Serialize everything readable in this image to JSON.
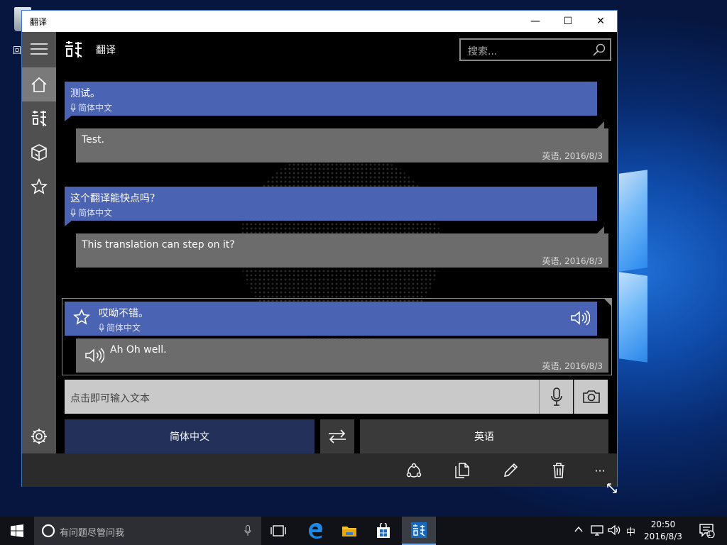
{
  "desktop": {
    "recycle_label": "回"
  },
  "window": {
    "title": "翻译",
    "controls": {
      "minimize": "—",
      "maximize": "☐",
      "close": "✕"
    }
  },
  "app": {
    "name": "翻译",
    "search_placeholder": "搜索..."
  },
  "conversation": [
    {
      "source_text": "测试。",
      "source_lang": "简体中文",
      "translation": "Test.",
      "meta": "英语, 2016/8/3"
    },
    {
      "source_text": "这个翻译能快点吗？",
      "source_lang": "简体中文",
      "translation": "This translation can step on it?",
      "meta": "英语, 2016/8/3"
    },
    {
      "source_text": "哎呦不错。",
      "source_lang": "简体中文",
      "translation": "Ah Oh well.",
      "meta": "英语, 2016/8/3",
      "selected": true
    }
  ],
  "input": {
    "placeholder": "点击即可输入文本"
  },
  "languages": {
    "from": "简体中文",
    "to": "英语"
  },
  "colors": {
    "source_bubble": "#4a63b3",
    "target_bubble": "#6c6c6c",
    "from_lang_button": "#22305a",
    "to_lang_button": "#3a3a3a",
    "command_bar": "#2b2b2b"
  },
  "commandbar": {
    "icons": [
      "share-icon",
      "copy-icon",
      "edit-icon",
      "delete-icon",
      "more-icon"
    ],
    "more_label": "···"
  },
  "taskbar": {
    "search_placeholder": "有问题尽管问我",
    "tray_ime": "中",
    "clock_time": "20:50",
    "clock_date": "2016/8/3",
    "notification_count": "1"
  }
}
